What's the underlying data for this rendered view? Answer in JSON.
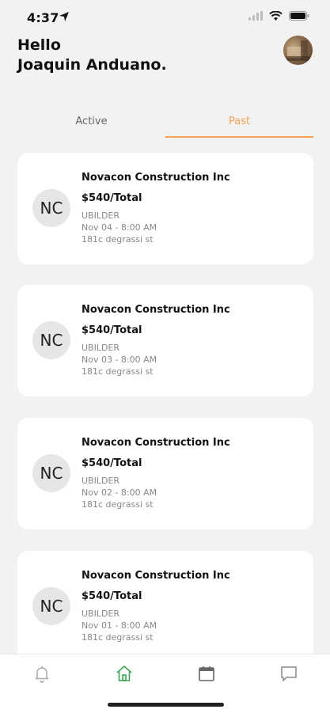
{
  "status_bar": {
    "time": "4:37"
  },
  "header": {
    "greeting_line1": "Hello",
    "greeting_line2": "Joaquin Anduano."
  },
  "tabs": [
    {
      "label": "Active",
      "selected": false
    },
    {
      "label": "Past",
      "selected": true
    }
  ],
  "accent_color": "#f5a255",
  "nav_active_color": "#3aa655",
  "bookings": [
    {
      "initials": "NC",
      "company": "Novacon Construction Inc",
      "price": "$540/Total",
      "platform": "UBILDER",
      "datetime": "Nov 04 - 8:00 AM",
      "address": "181c degrassi st"
    },
    {
      "initials": "NC",
      "company": "Novacon Construction Inc",
      "price": "$540/Total",
      "platform": "UBILDER",
      "datetime": "Nov 03 - 8:00 AM",
      "address": "181c degrassi st"
    },
    {
      "initials": "NC",
      "company": "Novacon Construction Inc",
      "price": "$540/Total",
      "platform": "UBILDER",
      "datetime": "Nov 02 - 8:00 AM",
      "address": "181c degrassi st"
    },
    {
      "initials": "NC",
      "company": "Novacon Construction Inc",
      "price": "$540/Total",
      "platform": "UBILDER",
      "datetime": "Nov 01 - 8:00 AM",
      "address": "181c degrassi st"
    }
  ],
  "bottom_nav": [
    {
      "icon": "bell-icon",
      "active": false
    },
    {
      "icon": "home-icon",
      "active": true
    },
    {
      "icon": "calendar-icon",
      "active": false
    },
    {
      "icon": "chat-icon",
      "active": false
    }
  ]
}
